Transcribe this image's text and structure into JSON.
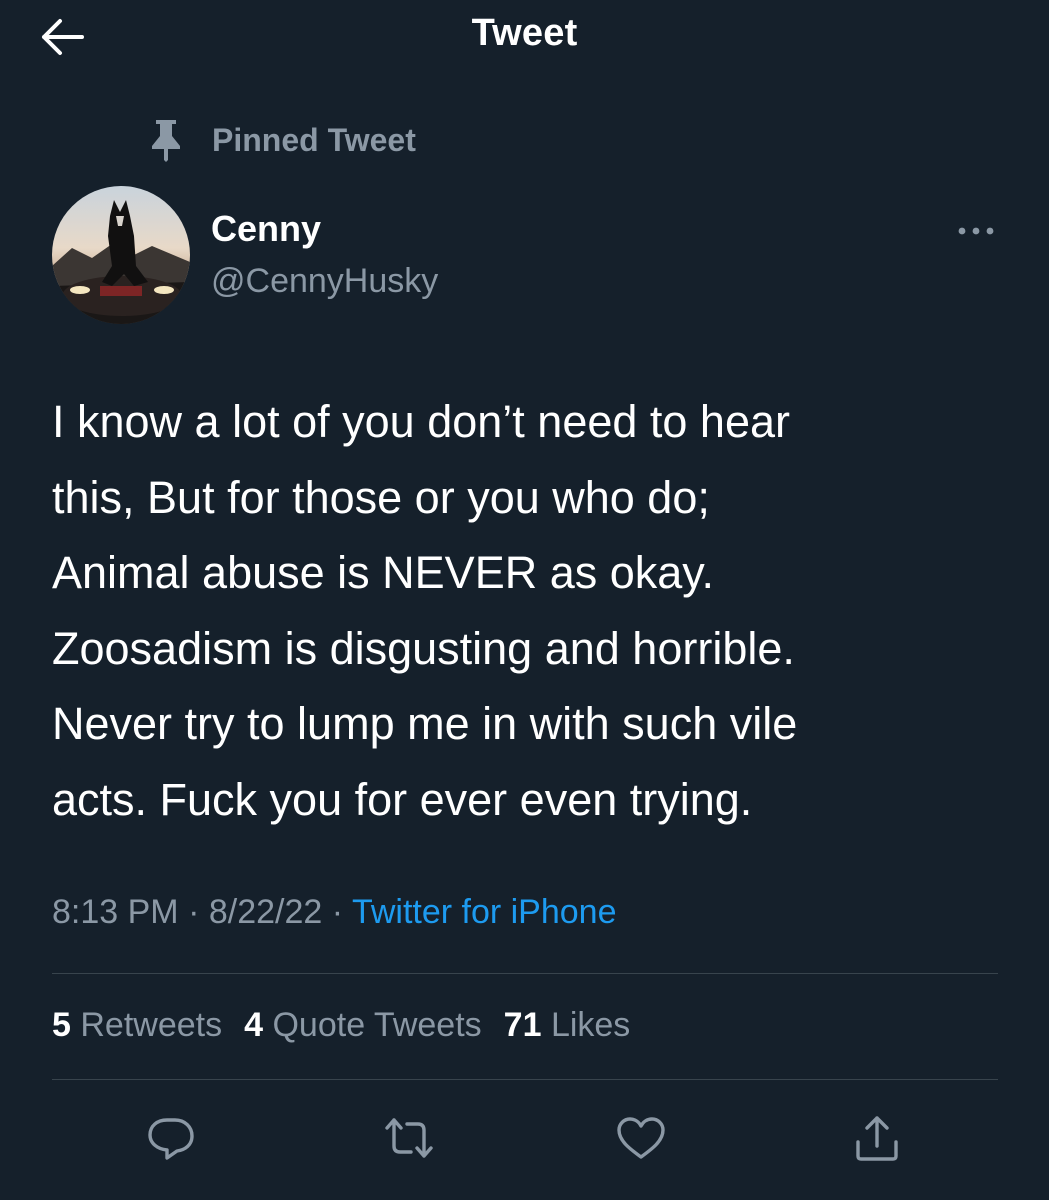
{
  "header": {
    "title": "Tweet",
    "back_icon": "arrow-left-icon"
  },
  "pinned": {
    "label": "Pinned Tweet",
    "icon": "pin-icon"
  },
  "author": {
    "name": "Cenny",
    "handle": "@CennyHusky",
    "more_icon": "more-options-icon"
  },
  "tweet": {
    "text": "I know a lot of you don’t need to hear\nthis, But for those or you who do;\nAnimal abuse is NEVER as okay.\nZoosadism is disgusting and horrible.\nNever try to lump me in with such vile\nacts. Fuck you for ever even trying."
  },
  "meta": {
    "time": "8:13 PM",
    "date": "8/22/22",
    "separator": "·",
    "source": "Twitter for iPhone"
  },
  "stats": {
    "retweets_count": "5",
    "retweets_label": "Retweets",
    "quotes_count": "4",
    "quotes_label": "Quote Tweets",
    "likes_count": "71",
    "likes_label": "Likes"
  },
  "actions": [
    "reply-icon",
    "retweet-icon",
    "like-icon",
    "share-icon"
  ],
  "colors": {
    "background": "#15202b",
    "text": "#ffffff",
    "secondary": "#8b98a5",
    "accent": "#1d9bf0",
    "divider": "#38444d"
  }
}
